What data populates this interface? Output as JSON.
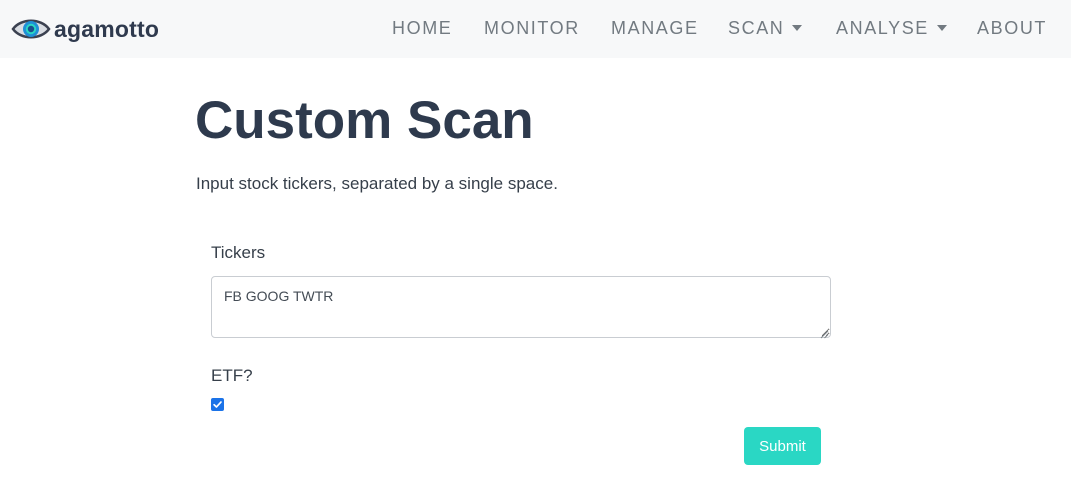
{
  "brand": {
    "name": "agamotto",
    "logo_icon": "eye-icon"
  },
  "nav": {
    "items": [
      {
        "label": "HOME"
      },
      {
        "label": "MONITOR"
      },
      {
        "label": "MANAGE"
      },
      {
        "label": "SCAN",
        "dropdown": true
      },
      {
        "label": "ANALYSE",
        "dropdown": true
      },
      {
        "label": "ABOUT"
      }
    ]
  },
  "page": {
    "title": "Custom Scan",
    "intro": "Input stock tickers, separated by a single space."
  },
  "form": {
    "tickers_label": "Tickers",
    "tickers_value": "FB GOOG TWTR",
    "etf_label": "ETF?",
    "etf_checked": true,
    "submit_label": "Submit"
  },
  "colors": {
    "accent": "#2ad7c4",
    "checkbox": "#1b73e8",
    "heading": "#2e3a4d",
    "nav_text": "#727a81",
    "navbar_bg": "#f7f8f9"
  }
}
